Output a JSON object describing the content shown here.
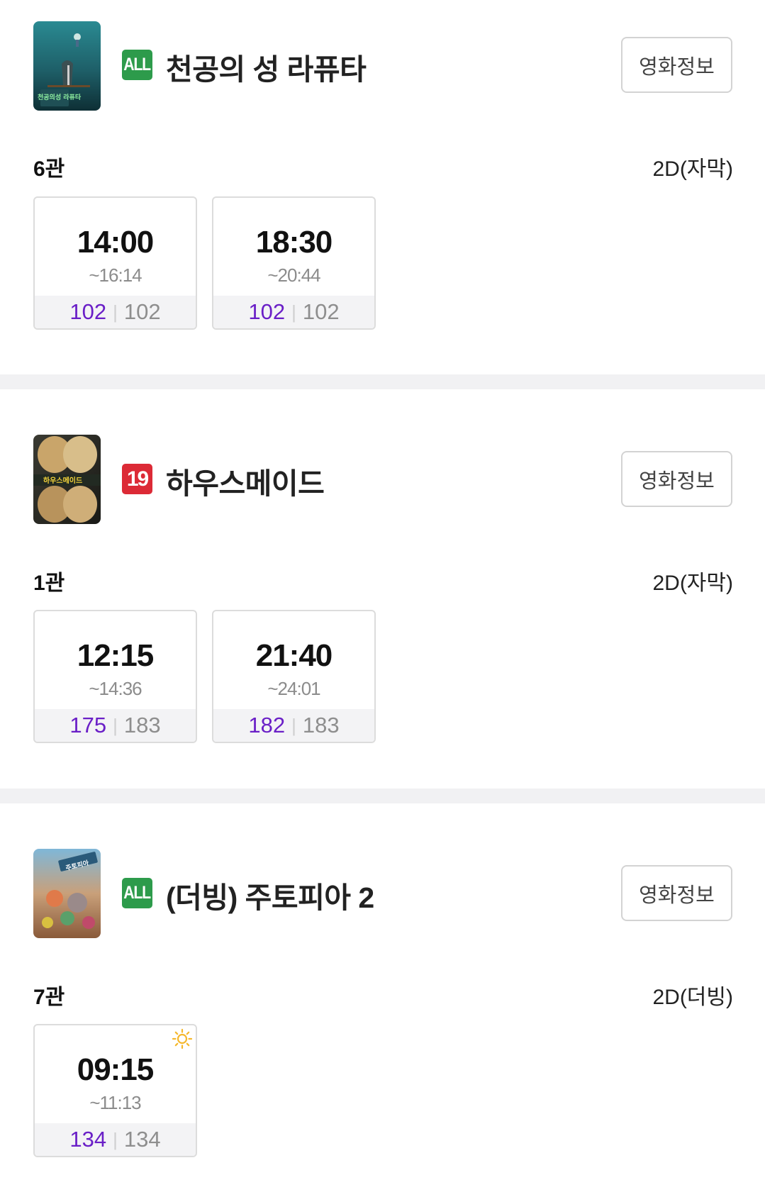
{
  "movies": [
    {
      "rating": "ALL",
      "title": "천공의 성 라퓨타",
      "info_button": "영화정보",
      "screen": "6관",
      "format": "2D(자막)",
      "showtimes": [
        {
          "start": "14:00",
          "end": "~16:14",
          "available": "102",
          "total": "102",
          "morning": false
        },
        {
          "start": "18:30",
          "end": "~20:44",
          "available": "102",
          "total": "102",
          "morning": false
        }
      ]
    },
    {
      "rating": "19",
      "title": "하우스메이드",
      "info_button": "영화정보",
      "screen": "1관",
      "format": "2D(자막)",
      "showtimes": [
        {
          "start": "12:15",
          "end": "~14:36",
          "available": "175",
          "total": "183",
          "morning": false
        },
        {
          "start": "21:40",
          "end": "~24:01",
          "available": "182",
          "total": "183",
          "morning": false
        }
      ]
    },
    {
      "rating": "ALL",
      "title": "(더빙) 주토피아 2",
      "info_button": "영화정보",
      "screen": "7관",
      "format": "2D(더빙)",
      "showtimes": [
        {
          "start": "09:15",
          "end": "~11:13",
          "available": "134",
          "total": "134",
          "morning": true
        }
      ]
    }
  ],
  "posters": {
    "laputa_text": "천공의성 라퓨타",
    "housemaid_text": "하우스메이드",
    "zootopia_text": "주토피아"
  },
  "colors": {
    "rating_all": "#2d9b4b",
    "rating_19": "#dc2a36",
    "available_seats": "#6a1fc7",
    "divider": "#f1f1f3",
    "morning_icon": "#f5b82e"
  },
  "icons": {
    "morning_show": "sun-icon"
  }
}
